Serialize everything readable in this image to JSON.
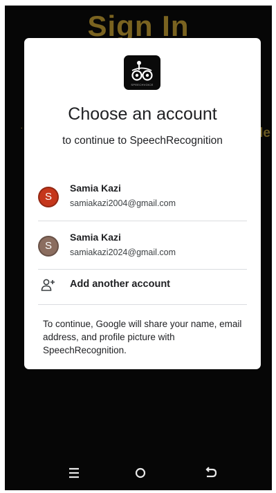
{
  "background": {
    "title": "Sign In",
    "edge_right": "le",
    "edge_left": "·"
  },
  "dialog": {
    "app_logo_caption": "SPEECHVOICE",
    "title": "Choose an account",
    "subtitle": "to continue to SpeechRecognition",
    "accounts": [
      {
        "initial": "S",
        "name": "Samia Kazi",
        "email": "samiakazi2004@gmail.com",
        "color": "#c5361b"
      },
      {
        "initial": "S",
        "name": "Samia Kazi",
        "email": "samiakazi2024@gmail.com",
        "color": "#8b6d5f"
      }
    ],
    "add_account_label": "Add another account",
    "notice": "To continue, Google will share your name, email address, and profile picture with SpeechRecognition."
  },
  "navbar": {
    "recent_icon": "recent-apps-icon",
    "home_icon": "home-icon",
    "back_icon": "back-icon"
  }
}
